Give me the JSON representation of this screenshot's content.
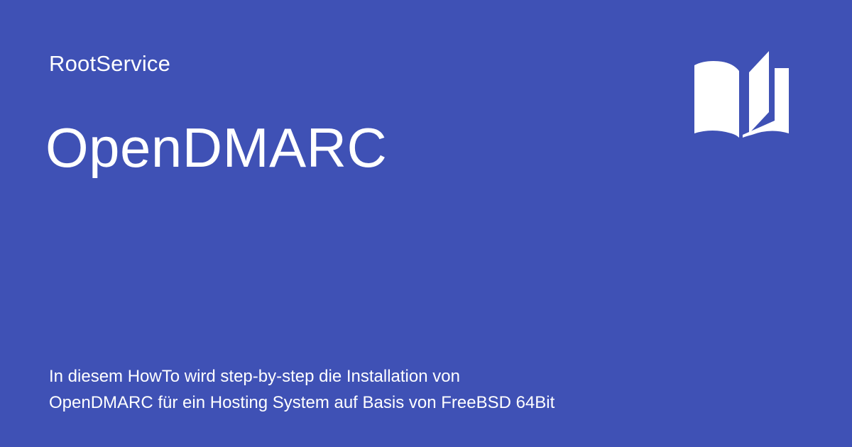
{
  "site": {
    "name": "RootService"
  },
  "page": {
    "title": "OpenDMARC",
    "description_lines": [
      "In diesem HowTo wird step-by-step die Installation von",
      "OpenDMARC für ein Hosting System auf Basis von FreeBSD 64Bit"
    ]
  },
  "icon": {
    "name": "open-book-icon"
  },
  "colors": {
    "background": "#3f51b5",
    "foreground": "#ffffff"
  }
}
